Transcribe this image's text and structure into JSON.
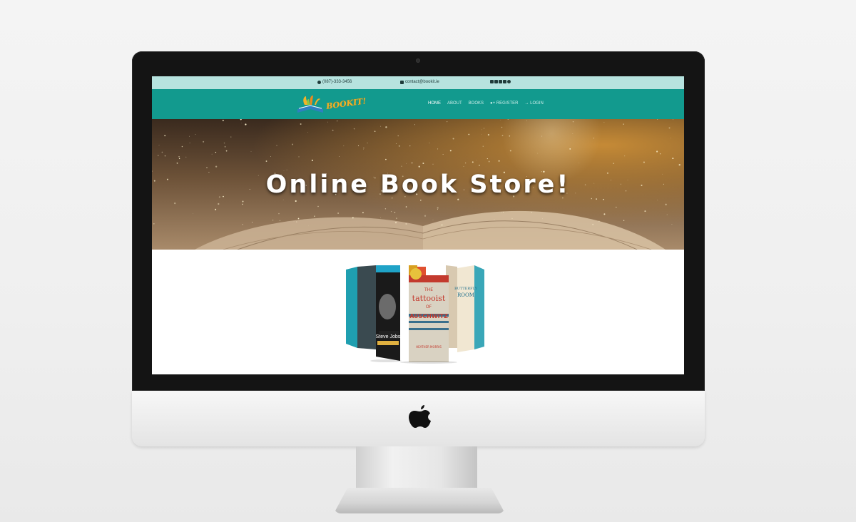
{
  "topbar": {
    "phone": "(087)-333-3456",
    "email": "contact@bookit.ie",
    "social_icons": [
      "twitter-icon",
      "facebook-icon",
      "linkedin-icon",
      "instagram-icon",
      "pinterest-icon"
    ]
  },
  "brand": {
    "logo_text": "BOOKIT!",
    "accent": "#f3b228"
  },
  "nav": {
    "items": [
      {
        "label": "HOME",
        "active": true
      },
      {
        "label": "ABOUT"
      },
      {
        "label": "BOOKS"
      },
      {
        "label": "REGISTER",
        "icon": "user-plus-icon"
      },
      {
        "label": "LOGIN",
        "icon": "sign-in-icon"
      }
    ]
  },
  "hero": {
    "title": "Online Book Store!"
  },
  "featured_books": {
    "left_cover_title": "Steve Jobs",
    "right_cover_line1": "THE",
    "right_cover_line2": "tattooist",
    "right_cover_line3": "OF",
    "right_cover_line4": "AUSCHWITZ",
    "right_cover_author": "HEATHER MORRIS",
    "far_right_title1": "BUTTERFLY",
    "far_right_title2": "ROOM"
  },
  "colors": {
    "topbar": "#b6e3df",
    "navbar": "#129a8e",
    "screen_bg": "#ffffff"
  }
}
